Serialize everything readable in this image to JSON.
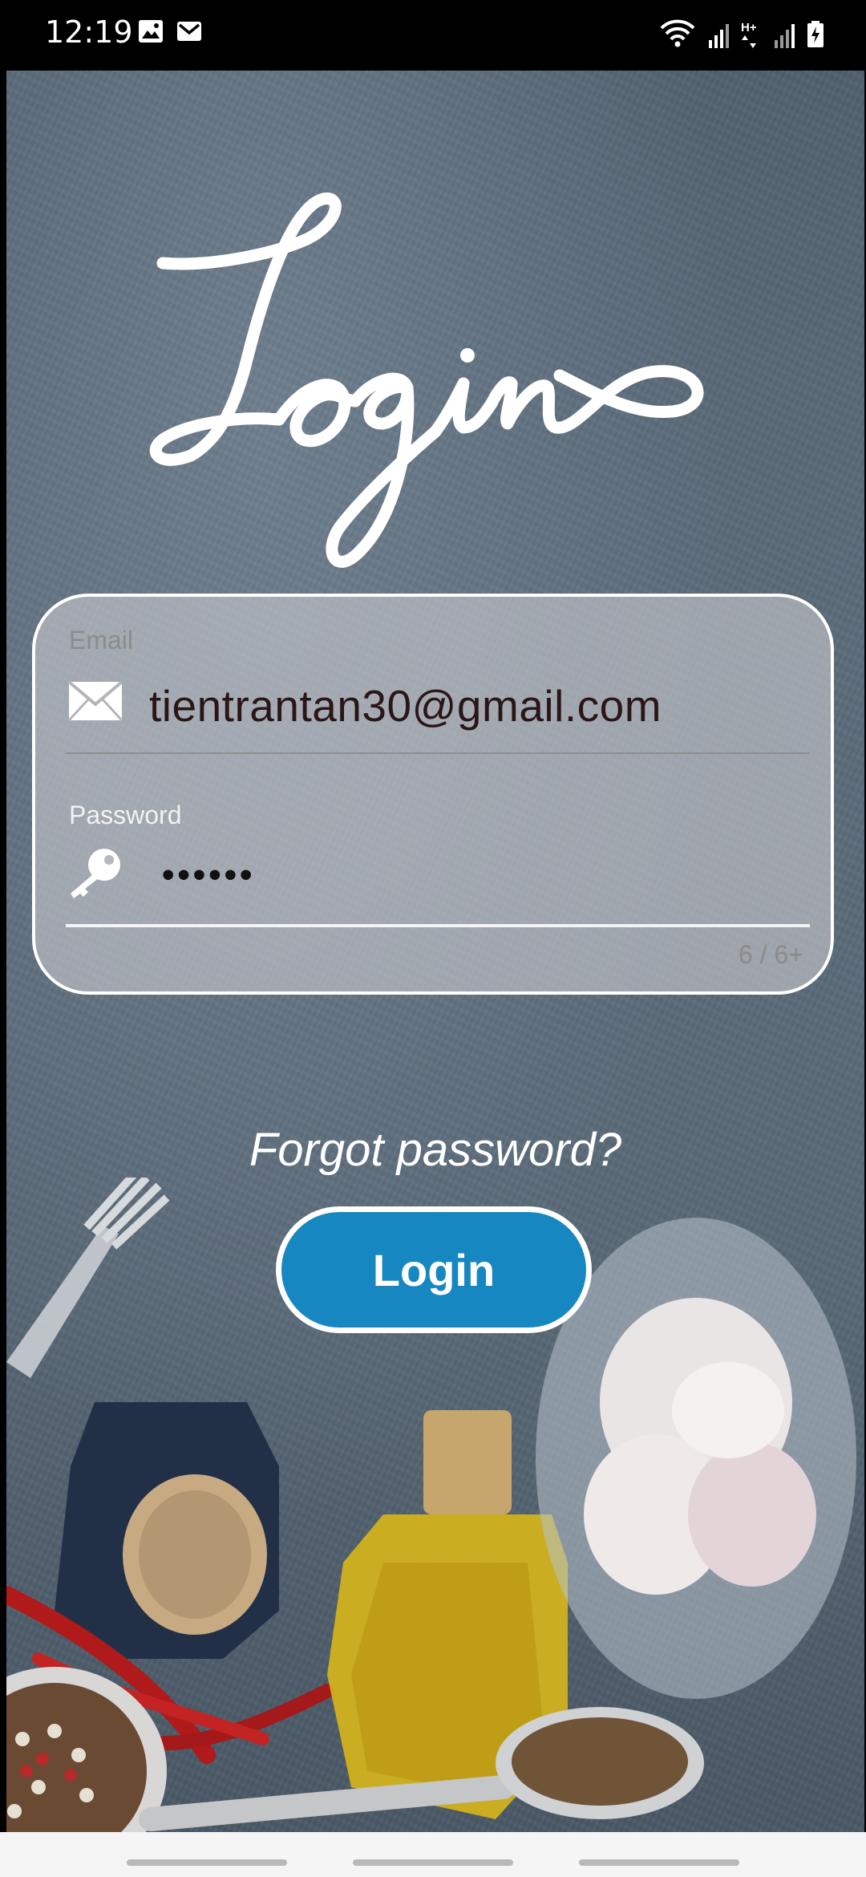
{
  "status_bar": {
    "time": "12:19",
    "left_icons": [
      "image-icon",
      "gmail-icon"
    ],
    "right_icons": [
      "wifi-icon",
      "signal-icon",
      "hplus-signal-icon",
      "battery-charging-icon"
    ],
    "network_label": "H+"
  },
  "logo": {
    "text": "Login"
  },
  "form": {
    "email": {
      "label": "Email",
      "value": "tientrantan30@gmail.com",
      "icon": "envelope-icon"
    },
    "password": {
      "label": "Password",
      "value": "••••••",
      "icon": "key-icon",
      "counter": "6 / 6+"
    }
  },
  "forgot_link": "Forgot password?",
  "login_button": "Login",
  "colors": {
    "accent": "#1787c1",
    "background": "#56656f",
    "card": "#c6c7cc"
  }
}
